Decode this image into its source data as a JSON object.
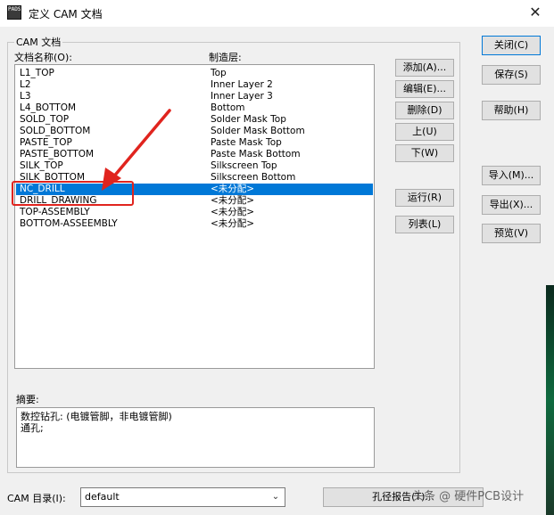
{
  "window": {
    "title": "定义 CAM 文档",
    "icon_text": "PADS"
  },
  "group": {
    "legend": "CAM 文档",
    "col_name": "文档名称(O):",
    "col_layer": "制造层:"
  },
  "documents": [
    {
      "name": "L1_TOP",
      "layer": "Top"
    },
    {
      "name": "L2",
      "layer": "Inner Layer 2"
    },
    {
      "name": "L3",
      "layer": "Inner Layer 3"
    },
    {
      "name": "L4_BOTTOM",
      "layer": "Bottom"
    },
    {
      "name": "SOLD_TOP",
      "layer": "Solder Mask Top"
    },
    {
      "name": "SOLD_BOTTOM",
      "layer": "Solder Mask Bottom"
    },
    {
      "name": "PASTE_TOP",
      "layer": "Paste Mask Top"
    },
    {
      "name": "PASTE_BOTTOM",
      "layer": "Paste Mask Bottom"
    },
    {
      "name": "SILK_TOP",
      "layer": "Silkscreen Top"
    },
    {
      "name": "SILK_BOTTOM",
      "layer": "Silkscreen Bottom"
    },
    {
      "name": "NC_DRILL",
      "layer": "<未分配>"
    },
    {
      "name": "DRILL_DRAWING",
      "layer": "<未分配>"
    },
    {
      "name": "TOP-ASSEMBLY",
      "layer": "<未分配>"
    },
    {
      "name": "BOTTOM-ASSEEMBLY",
      "layer": "<未分配>"
    }
  ],
  "selected_index": 10,
  "mid_buttons": {
    "add": "添加(A)...",
    "edit": "编辑(E)...",
    "delete": "删除(D)",
    "up": "上(U)",
    "down": "下(W)",
    "run": "运行(R)",
    "list": "列表(L)"
  },
  "side_buttons": {
    "close": "关闭(C)",
    "save": "保存(S)",
    "help": "帮助(H)",
    "import": "导入(M)...",
    "export": "导出(X)...",
    "preview": "预览(V)"
  },
  "summary": {
    "label": "摘要:",
    "line1": "数控钻孔: (电镀管脚，非电镀管脚)",
    "line2": "通孔;"
  },
  "footer": {
    "cam_dir_label": "CAM 目录(I):",
    "cam_dir_value": "default",
    "hole_report": "孔径报告(T)..."
  },
  "watermark": "头条 @ 硬件PCB设计",
  "colors": {
    "selection": "#0078d7",
    "annotation": "#e0241e"
  }
}
